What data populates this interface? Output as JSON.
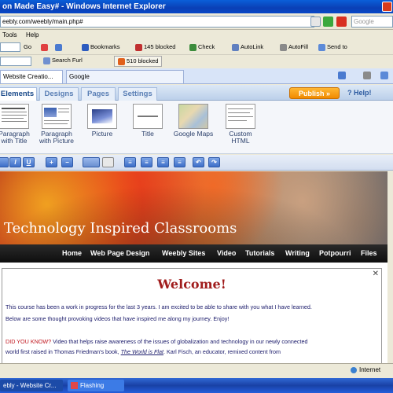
{
  "window": {
    "title": "on Made Easy# - Windows Internet Explorer"
  },
  "address": {
    "url": "eebly.com/weebly/main.php#",
    "search_placeholder": "Google"
  },
  "menu": {
    "items": [
      "Tools",
      "Help"
    ]
  },
  "toolbar": {
    "go_label": "Go",
    "bookmarks_label": "Bookmarks",
    "blocked_label": "145 blocked",
    "check_label": "Check",
    "autolink_label": "AutoLink",
    "autofill_label": "AutoFill",
    "sendto_label": "Send to",
    "search_furl_label": "Search Furl",
    "blocked2_label": "510 blocked"
  },
  "browser_tabs": [
    {
      "label": "Website Creatio..."
    },
    {
      "label": "Google"
    }
  ],
  "weebly": {
    "tabs": [
      "Elements",
      "Designs",
      "Pages",
      "Settings"
    ],
    "publish_label": "Publish »",
    "help_label": "Help!",
    "elements": [
      {
        "label": "Paragraph with Title"
      },
      {
        "label": "Paragraph with Picture"
      },
      {
        "label": "Picture"
      },
      {
        "label": "Title"
      },
      {
        "label": "Google Maps"
      },
      {
        "label": "Custom HTML"
      }
    ],
    "edit_buttons": [
      "I",
      "U"
    ]
  },
  "site": {
    "title": "Technology Inspired Classrooms",
    "nav": [
      "Home",
      "Web Page Design",
      "Weebly Sites",
      "Video",
      "Tutorials",
      "Writing",
      "Potpourri",
      "Files"
    ],
    "welcome": "Welcome!",
    "para1": "This course has been a work in progress for the last 3 years.  I am excited to be able to share with you what I have learned.",
    "para2": "Below are some thought provoking videos that have inspired me along my journey.  Enjoy!",
    "did_you_know": "DID YOU KNOW?",
    "para3a": " Video that helps raise awareness of the issues of globalization and technology in our newly connected",
    "para3b_start": "world first raised in Thomas Friedman's book, ",
    "para3b_book": "The World is Flat",
    "para3b_end": ". Karl Fisch, an educator, remixed content from"
  },
  "status": {
    "zone": "Internet"
  },
  "taskbar": {
    "items": [
      "ebly - Website Cr...",
      "Flashing"
    ]
  },
  "colors": {
    "ie_titlebar": "#0a3fb5",
    "publish_orange": "#f08a00",
    "welcome_red": "#a01c1c",
    "nav_bar": "#0e0e0e"
  }
}
